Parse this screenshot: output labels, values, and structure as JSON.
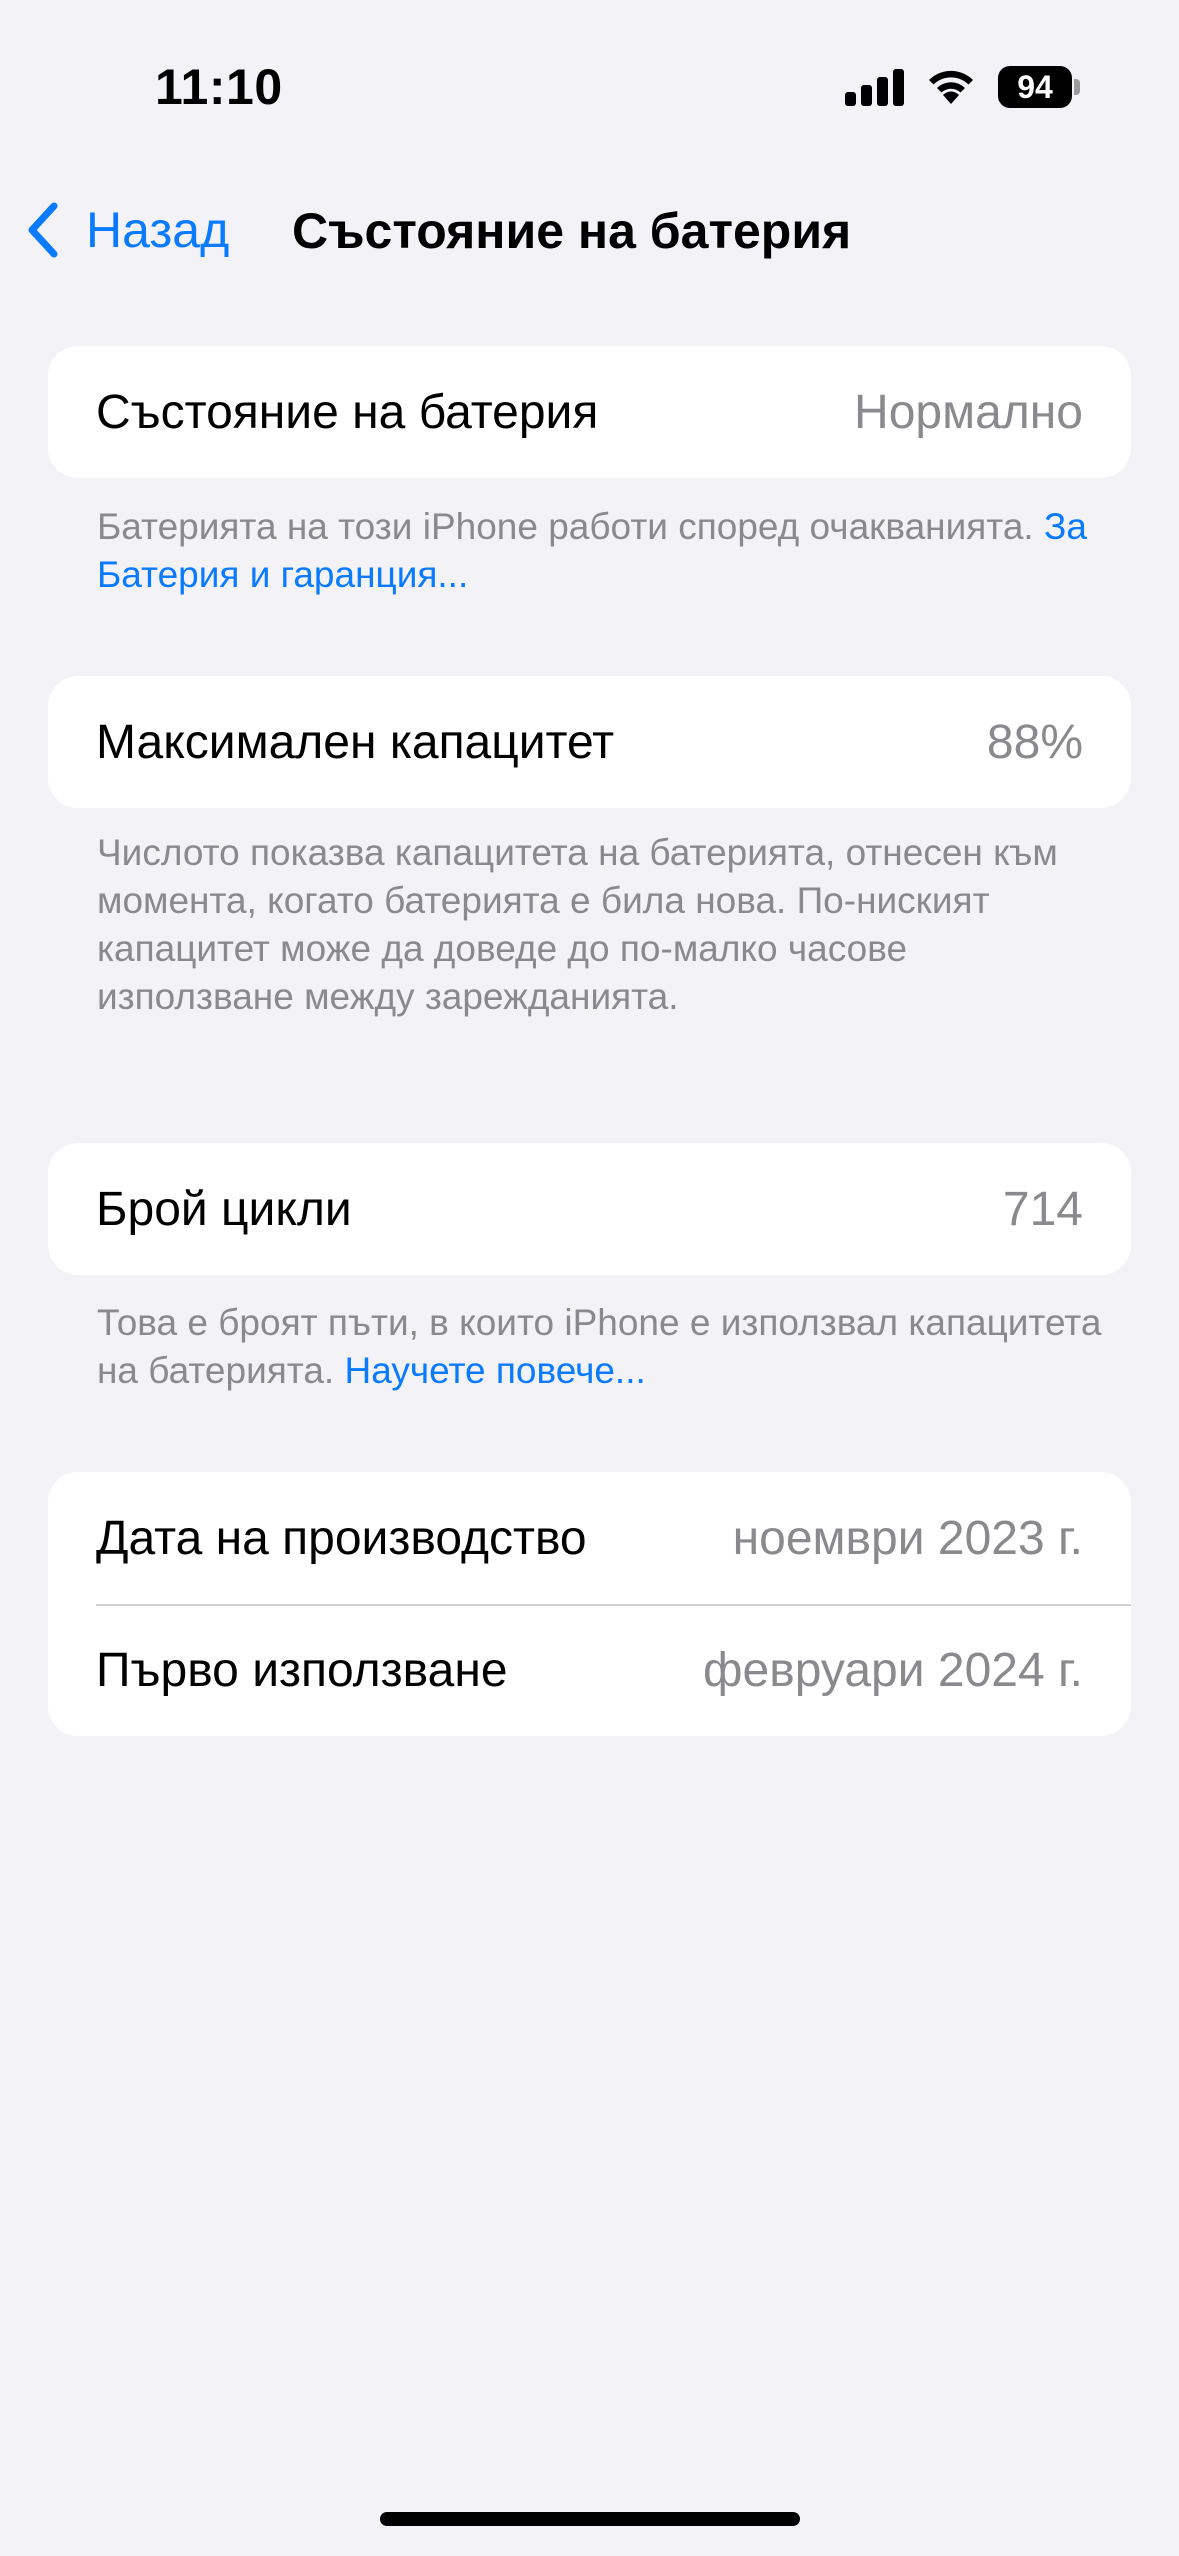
{
  "status_bar": {
    "time": "11:10",
    "battery_level": "94",
    "icons": [
      "cellular-signal-icon",
      "wifi-icon",
      "battery-icon"
    ]
  },
  "nav": {
    "back_label": "Назад",
    "title": "Състояние на батерия"
  },
  "battery_health": {
    "label": "Състояние на батерия",
    "value": "Нормално",
    "footnote": "Батерията на този iPhone работи според очакванията.",
    "footnote_link": "За Батерия и гаранция..."
  },
  "max_capacity": {
    "label": "Максимален капацитет",
    "value": "88%",
    "footnote": "Числото показва капацитета на батерията, отнесен към момента, когато батерията е била нова. По-ниският капацитет може да доведе до по-малко часове използване между зарежданията."
  },
  "cycle_count": {
    "label": "Брой цикли",
    "value": "714",
    "footnote": "Това е броят пъти, в които iPhone е използвал капацитета на батерията.",
    "footnote_link": "Научете повече..."
  },
  "dates": {
    "manufacture_label": "Дата на производство",
    "manufacture_value": "ноември 2023 г.",
    "first_use_label": "Първо използване",
    "first_use_value": "февруари 2024 г."
  },
  "colors": {
    "accent": "#0a7aff",
    "background": "#f2f2f7",
    "secondary_text": "#8a8a8e"
  }
}
